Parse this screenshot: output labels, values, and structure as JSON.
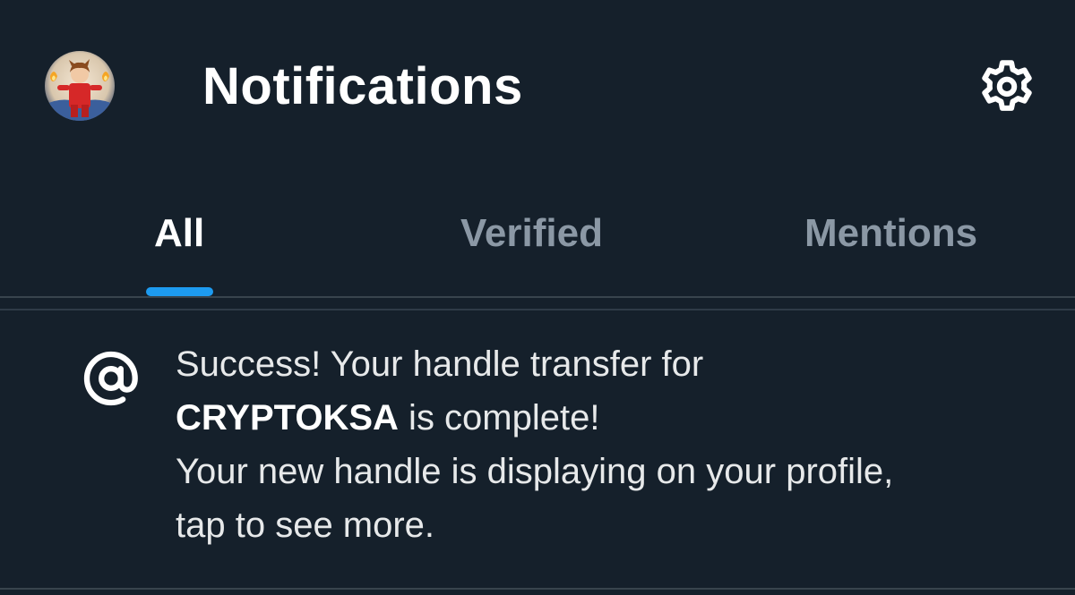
{
  "header": {
    "title": "Notifications",
    "avatar_icon": "user-avatar",
    "settings_icon": "gear-icon"
  },
  "tabs": [
    {
      "label": "All",
      "active": true
    },
    {
      "label": "Verified",
      "active": false
    },
    {
      "label": "Mentions",
      "active": false
    }
  ],
  "notification": {
    "icon": "at-sign-icon",
    "line1": "Success! Your handle transfer for",
    "handle": "CRYPTOKSA",
    "line2_rest": " is complete!",
    "line3": "Your new handle is displaying on your profile,",
    "line4": "tap to see more."
  },
  "colors": {
    "background": "#15202b",
    "accent": "#1d9bf0",
    "muted_text": "#8b98a5",
    "divider": "#38444d"
  }
}
